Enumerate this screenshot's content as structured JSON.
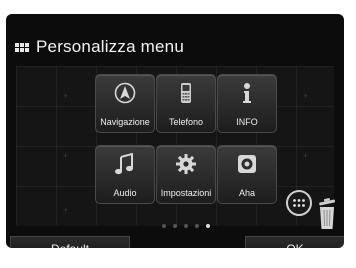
{
  "header": {
    "title": "Personalizza menu"
  },
  "tiles": [
    {
      "label": "Navigazione",
      "icon": "navigation-icon"
    },
    {
      "label": "Telefono",
      "icon": "phone-icon"
    },
    {
      "label": "INFO",
      "icon": "info-icon"
    },
    {
      "label": "Audio",
      "icon": "music-note-icon"
    },
    {
      "label": "Impostazioni",
      "icon": "gear-icon"
    },
    {
      "label": "Aha",
      "icon": "aha-icon"
    }
  ],
  "pager": {
    "pages": 5,
    "current": 5
  },
  "footer": {
    "default_label": "Default",
    "ok_label": "OK"
  }
}
